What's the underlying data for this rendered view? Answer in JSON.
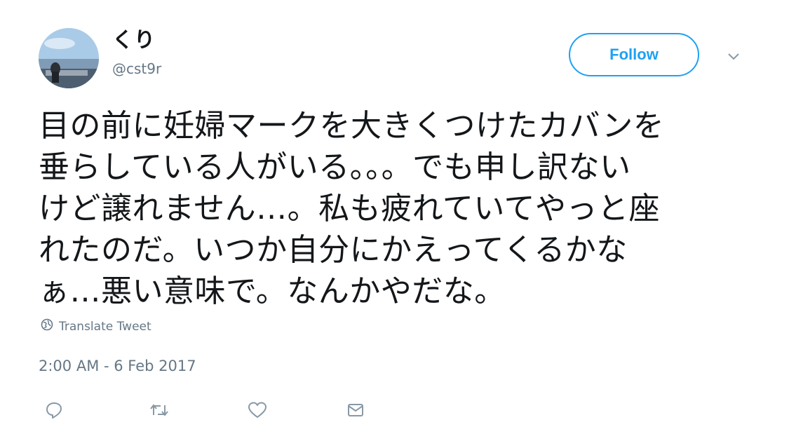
{
  "user": {
    "display_name": "くり",
    "handle": "@cst9r"
  },
  "follow_button": {
    "label": "Follow"
  },
  "tweet": {
    "text": "目の前に妊婦マークを大きくつけたカバンを\n垂らしている人がいる。。。でも申し訳ない\nけど譲れません…。私も疲れていてやっと座\nれたのだ。いつか自分にかえってくるかな\nぁ…悪い意味で。なんかやだな。",
    "translate_label": "Translate Tweet",
    "timestamp": "2:00 AM - 6 Feb 2017"
  },
  "icons": {
    "reply": "reply-icon",
    "retweet": "retweet-icon",
    "like": "heart-icon",
    "dm": "envelope-icon",
    "globe": "globe-icon",
    "caret": "chevron-down-icon"
  },
  "colors": {
    "accent": "#1da1f2",
    "text": "#14171a",
    "secondary": "#657786"
  }
}
